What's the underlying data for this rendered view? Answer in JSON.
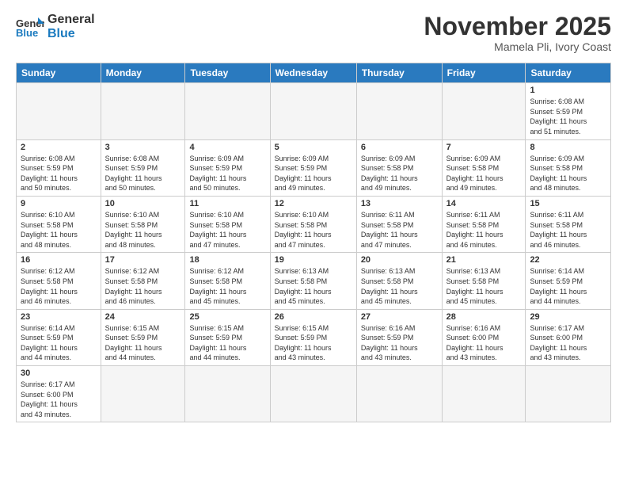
{
  "header": {
    "logo_general": "General",
    "logo_blue": "Blue",
    "month_title": "November 2025",
    "location": "Mamela Pli, Ivory Coast"
  },
  "days_of_week": [
    "Sunday",
    "Monday",
    "Tuesday",
    "Wednesday",
    "Thursday",
    "Friday",
    "Saturday"
  ],
  "weeks": [
    [
      {
        "day": "",
        "info": ""
      },
      {
        "day": "",
        "info": ""
      },
      {
        "day": "",
        "info": ""
      },
      {
        "day": "",
        "info": ""
      },
      {
        "day": "",
        "info": ""
      },
      {
        "day": "",
        "info": ""
      },
      {
        "day": "1",
        "info": "Sunrise: 6:08 AM\nSunset: 5:59 PM\nDaylight: 11 hours\nand 51 minutes."
      }
    ],
    [
      {
        "day": "2",
        "info": "Sunrise: 6:08 AM\nSunset: 5:59 PM\nDaylight: 11 hours\nand 50 minutes."
      },
      {
        "day": "3",
        "info": "Sunrise: 6:08 AM\nSunset: 5:59 PM\nDaylight: 11 hours\nand 50 minutes."
      },
      {
        "day": "4",
        "info": "Sunrise: 6:09 AM\nSunset: 5:59 PM\nDaylight: 11 hours\nand 50 minutes."
      },
      {
        "day": "5",
        "info": "Sunrise: 6:09 AM\nSunset: 5:59 PM\nDaylight: 11 hours\nand 49 minutes."
      },
      {
        "day": "6",
        "info": "Sunrise: 6:09 AM\nSunset: 5:58 PM\nDaylight: 11 hours\nand 49 minutes."
      },
      {
        "day": "7",
        "info": "Sunrise: 6:09 AM\nSunset: 5:58 PM\nDaylight: 11 hours\nand 49 minutes."
      },
      {
        "day": "8",
        "info": "Sunrise: 6:09 AM\nSunset: 5:58 PM\nDaylight: 11 hours\nand 48 minutes."
      }
    ],
    [
      {
        "day": "9",
        "info": "Sunrise: 6:10 AM\nSunset: 5:58 PM\nDaylight: 11 hours\nand 48 minutes."
      },
      {
        "day": "10",
        "info": "Sunrise: 6:10 AM\nSunset: 5:58 PM\nDaylight: 11 hours\nand 48 minutes."
      },
      {
        "day": "11",
        "info": "Sunrise: 6:10 AM\nSunset: 5:58 PM\nDaylight: 11 hours\nand 47 minutes."
      },
      {
        "day": "12",
        "info": "Sunrise: 6:10 AM\nSunset: 5:58 PM\nDaylight: 11 hours\nand 47 minutes."
      },
      {
        "day": "13",
        "info": "Sunrise: 6:11 AM\nSunset: 5:58 PM\nDaylight: 11 hours\nand 47 minutes."
      },
      {
        "day": "14",
        "info": "Sunrise: 6:11 AM\nSunset: 5:58 PM\nDaylight: 11 hours\nand 46 minutes."
      },
      {
        "day": "15",
        "info": "Sunrise: 6:11 AM\nSunset: 5:58 PM\nDaylight: 11 hours\nand 46 minutes."
      }
    ],
    [
      {
        "day": "16",
        "info": "Sunrise: 6:12 AM\nSunset: 5:58 PM\nDaylight: 11 hours\nand 46 minutes."
      },
      {
        "day": "17",
        "info": "Sunrise: 6:12 AM\nSunset: 5:58 PM\nDaylight: 11 hours\nand 46 minutes."
      },
      {
        "day": "18",
        "info": "Sunrise: 6:12 AM\nSunset: 5:58 PM\nDaylight: 11 hours\nand 45 minutes."
      },
      {
        "day": "19",
        "info": "Sunrise: 6:13 AM\nSunset: 5:58 PM\nDaylight: 11 hours\nand 45 minutes."
      },
      {
        "day": "20",
        "info": "Sunrise: 6:13 AM\nSunset: 5:58 PM\nDaylight: 11 hours\nand 45 minutes."
      },
      {
        "day": "21",
        "info": "Sunrise: 6:13 AM\nSunset: 5:58 PM\nDaylight: 11 hours\nand 45 minutes."
      },
      {
        "day": "22",
        "info": "Sunrise: 6:14 AM\nSunset: 5:59 PM\nDaylight: 11 hours\nand 44 minutes."
      }
    ],
    [
      {
        "day": "23",
        "info": "Sunrise: 6:14 AM\nSunset: 5:59 PM\nDaylight: 11 hours\nand 44 minutes."
      },
      {
        "day": "24",
        "info": "Sunrise: 6:15 AM\nSunset: 5:59 PM\nDaylight: 11 hours\nand 44 minutes."
      },
      {
        "day": "25",
        "info": "Sunrise: 6:15 AM\nSunset: 5:59 PM\nDaylight: 11 hours\nand 44 minutes."
      },
      {
        "day": "26",
        "info": "Sunrise: 6:15 AM\nSunset: 5:59 PM\nDaylight: 11 hours\nand 43 minutes."
      },
      {
        "day": "27",
        "info": "Sunrise: 6:16 AM\nSunset: 5:59 PM\nDaylight: 11 hours\nand 43 minutes."
      },
      {
        "day": "28",
        "info": "Sunrise: 6:16 AM\nSunset: 6:00 PM\nDaylight: 11 hours\nand 43 minutes."
      },
      {
        "day": "29",
        "info": "Sunrise: 6:17 AM\nSunset: 6:00 PM\nDaylight: 11 hours\nand 43 minutes."
      }
    ],
    [
      {
        "day": "30",
        "info": "Sunrise: 6:17 AM\nSunset: 6:00 PM\nDaylight: 11 hours\nand 43 minutes."
      },
      {
        "day": "",
        "info": ""
      },
      {
        "day": "",
        "info": ""
      },
      {
        "day": "",
        "info": ""
      },
      {
        "day": "",
        "info": ""
      },
      {
        "day": "",
        "info": ""
      },
      {
        "day": "",
        "info": ""
      }
    ]
  ]
}
